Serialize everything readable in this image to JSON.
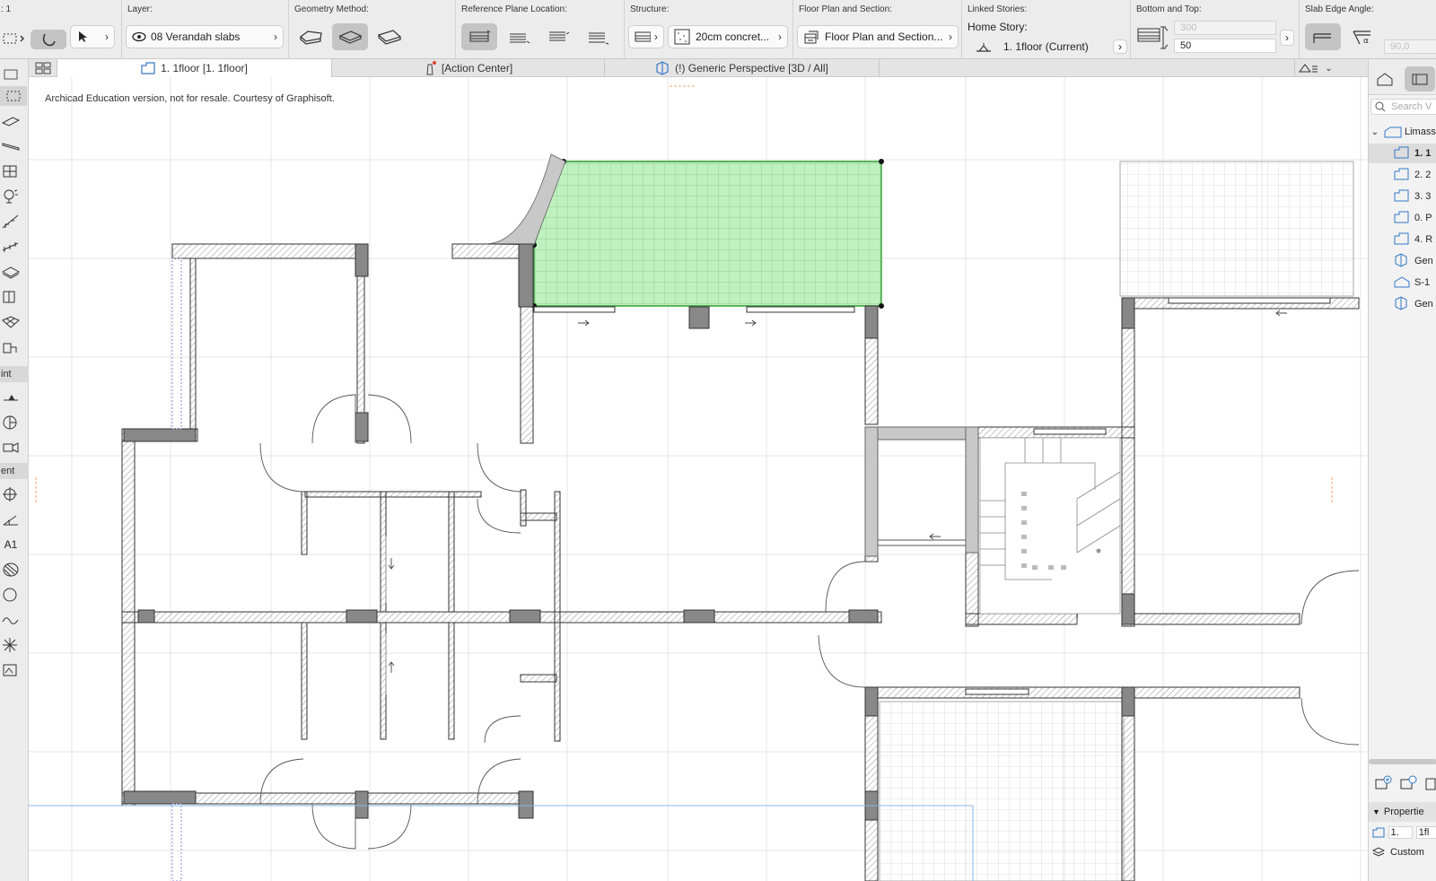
{
  "infobox": {
    "left_label": ": 1",
    "layer": {
      "title": "Layer:",
      "value": "08 Verandah slabs"
    },
    "geometry": {
      "title": "Geometry Method:"
    },
    "refplane": {
      "title": "Reference Plane Location:"
    },
    "structure": {
      "title": "Structure:",
      "value": "20cm concret..."
    },
    "floorplan": {
      "title": "Floor Plan and Section:",
      "value": "Floor Plan and Section..."
    },
    "linked": {
      "title": "Linked Stories:",
      "home_story_label": "Home Story:",
      "home_story_value": "1. 1floor  (Current)"
    },
    "bottomtop": {
      "title": "Bottom and Top:",
      "top_value": "300",
      "bottom_value": "50"
    },
    "edge": {
      "title": "Slab Edge Angle:",
      "value": "90,0"
    }
  },
  "tabs": [
    {
      "label": "1. 1floor  [1. 1floor]",
      "icon": "floor-plan-icon"
    },
    {
      "label": "[Action Center]",
      "icon": "lighthouse-icon"
    },
    {
      "label": "(!) Generic Perspective [3D / All]",
      "icon": "3d-view-icon"
    }
  ],
  "toolbox": {
    "group_point": "int",
    "group_element": "ent",
    "label_tool": "A1"
  },
  "canvas": {
    "watermark": "Archicad Education version, not for resale. Courtesy of Graphisoft.",
    "selection_color": "#bff0bf",
    "selection_stroke": "#2f9e2f"
  },
  "navigator": {
    "search_placeholder": "Search V",
    "project": "Limass",
    "items": [
      {
        "label": "1. 1",
        "type": "story",
        "selected": true
      },
      {
        "label": "2. 2",
        "type": "story"
      },
      {
        "label": "3. 3",
        "type": "story"
      },
      {
        "label": "0. P",
        "type": "story"
      },
      {
        "label": "4. R",
        "type": "story"
      },
      {
        "label": "Gen",
        "type": "perspective"
      },
      {
        "label": "S-1",
        "type": "section"
      },
      {
        "label": "Gen",
        "type": "perspective"
      }
    ],
    "properties_title": "Propertie",
    "prop_id": "1.",
    "prop_name": "1fl",
    "prop_custom": "Custom"
  }
}
